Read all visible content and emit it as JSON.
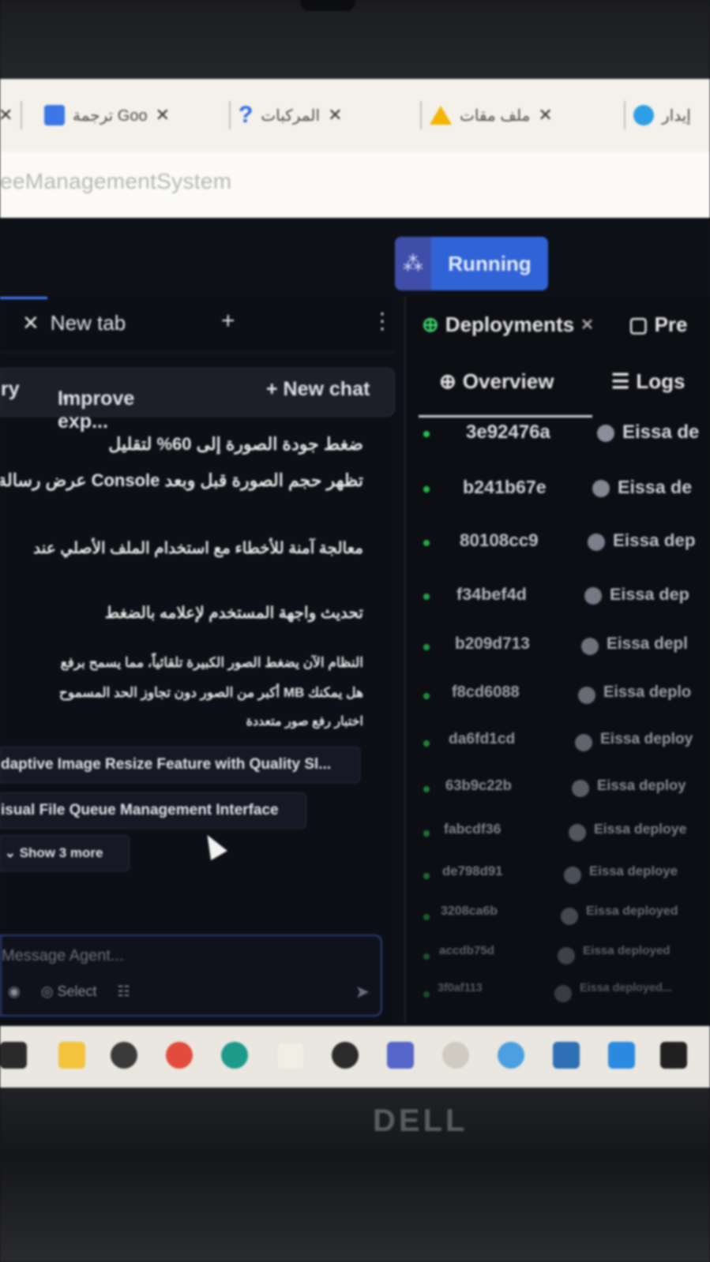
{
  "browser": {
    "tabs": [
      {
        "label": "ترجمة Goo",
        "icon": "translate-icon"
      },
      {
        "label": "المركبات",
        "icon": "help-icon"
      },
      {
        "label": "ملف مقات",
        "icon": "drive-icon"
      },
      {
        "label": "إيدار",
        "icon": "edge-icon"
      }
    ],
    "address": "eeManagementSystem"
  },
  "app": {
    "run_label": "Running",
    "left": {
      "tab_label": "New tab",
      "toolbar": {
        "history": "ry",
        "improve": "Improve exp...",
        "new_chat": "+ New chat"
      },
      "messages": [
        "ضغط جودة الصورة إلى 60% لتقليل",
        "تظهر حجم الصورة قبل وبعد Console عرض رسالة",
        "معالجة آمنة للأخطاء مع استخدام الملف الأصلي عند",
        "تحديث واجهة المستخدم لإعلامه بالضغط",
        "النظام الآن يضغط الصور الكبيرة تلقائياً، مما يسمح برفع",
        "هل يمكنك MB أكبر من الصور دون تجاوز الحد المسموح",
        "اختبار رفع صور متعددة"
      ],
      "chips": [
        "daptive Image Resize Feature with Quality Sl...",
        "isual File Queue Management Interface",
        "Show 3 more"
      ],
      "input_placeholder": "Message Agent...",
      "select_label": "Select"
    },
    "right": {
      "tab_label": "Deployments",
      "tab2_label": "Pre",
      "overview": "Overview",
      "logs": "Logs",
      "deployments": [
        {
          "hash": "3e92476a",
          "who": "Eissa de"
        },
        {
          "hash": "b241b67e",
          "who": "Eissa de"
        },
        {
          "hash": "80108cc9",
          "who": "Eissa dep"
        },
        {
          "hash": "f34bef4d",
          "who": "Eissa dep"
        },
        {
          "hash": "b209d713",
          "who": "Eissa depl"
        },
        {
          "hash": "f8cd6088",
          "who": "Eissa deplo"
        },
        {
          "hash": "da6fd1cd",
          "who": "Eissa deploy"
        },
        {
          "hash": "63b9c22b",
          "who": "Eissa deploy"
        },
        {
          "hash": "fabcdf36",
          "who": "Eissa deploye"
        },
        {
          "hash": "de798d91",
          "who": "Eissa deploye"
        },
        {
          "hash": "3208ca6b",
          "who": "Eissa deployed"
        },
        {
          "hash": "accdb75d",
          "who": "Eissa deployed"
        },
        {
          "hash": "3f0af113",
          "who": "Eissa deployed..."
        }
      ]
    }
  },
  "hardware": {
    "brand": "DELL"
  }
}
